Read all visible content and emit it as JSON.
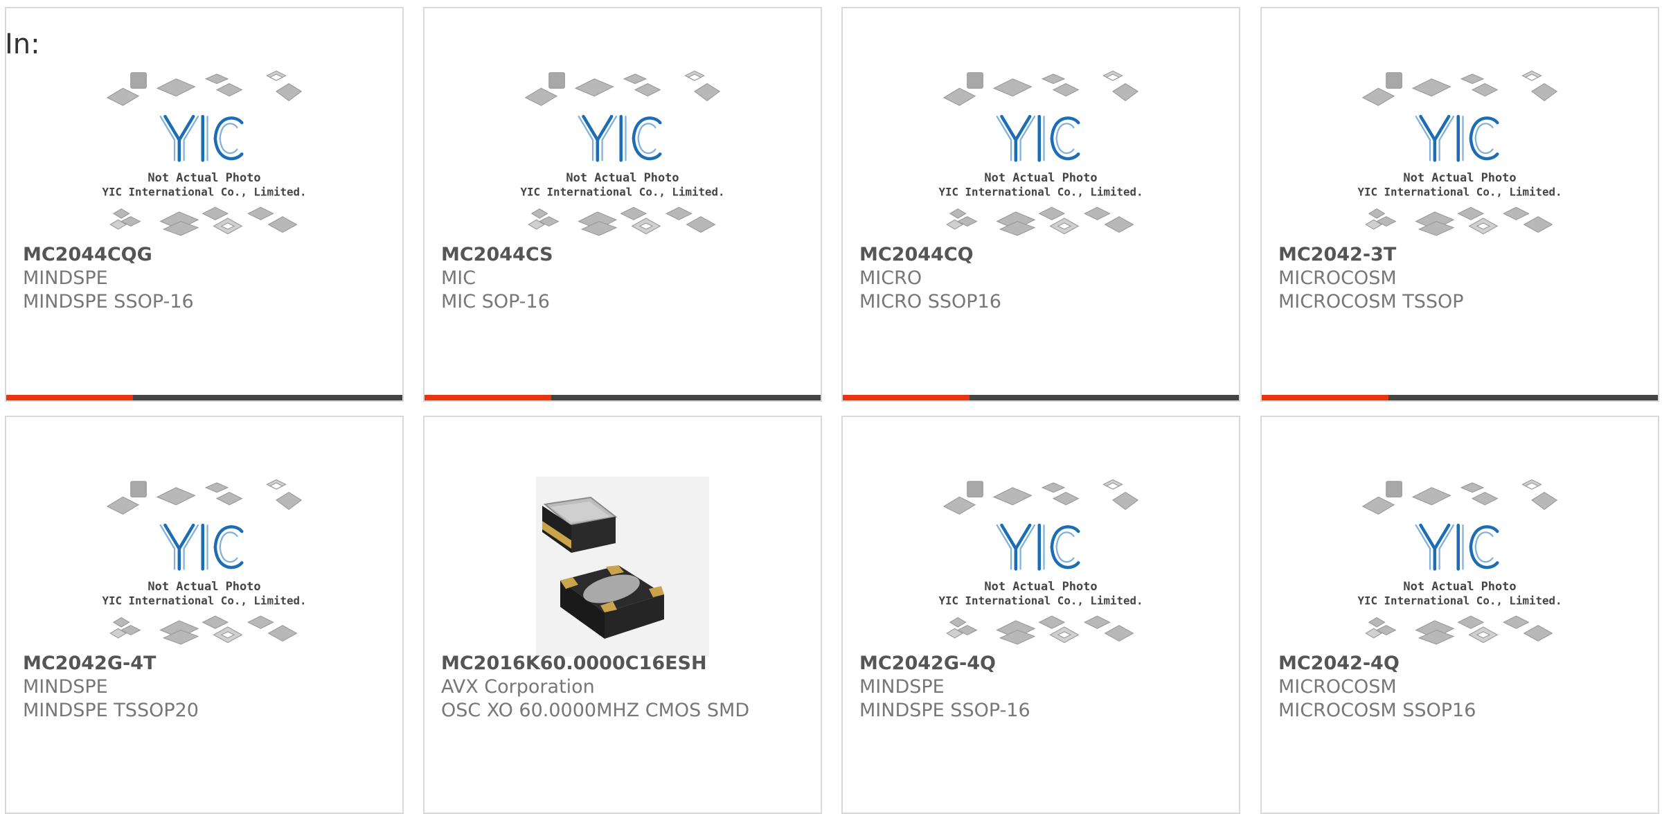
{
  "page": {
    "label": "In:"
  },
  "theme": {
    "accent": "#e8340f",
    "bar": "#444444",
    "border": "#d9d9d9",
    "logo_blue": "#1d6db5"
  },
  "placeholder_image": {
    "icon": "yic-placeholder-icon",
    "caption_line1": "Not Actual Photo",
    "caption_line2": "YIC International Co., Limited."
  },
  "products": [
    {
      "part_number": "MC2044CQG",
      "manufacturer": "MINDSPE",
      "description": "MINDSPE SSOP-16",
      "image": "placeholder"
    },
    {
      "part_number": "MC2044CS",
      "manufacturer": "MIC",
      "description": "MIC SOP-16",
      "image": "placeholder"
    },
    {
      "part_number": "MC2044CQ",
      "manufacturer": "MICRO",
      "description": "MICRO SSOP16",
      "image": "placeholder"
    },
    {
      "part_number": "MC2042-3T",
      "manufacturer": "MICROCOSM",
      "description": "MICROCOSM TSSOP",
      "image": "placeholder"
    },
    {
      "part_number": "MC2042G-4T",
      "manufacturer": "MINDSPE",
      "description": "MINDSPE TSSOP20",
      "image": "placeholder"
    },
    {
      "part_number": "MC2016K60.0000C16ESH",
      "manufacturer": "AVX Corporation",
      "description": "OSC XO 60.0000MHZ CMOS SMD",
      "image": "oscillator-photo"
    },
    {
      "part_number": "MC2042G-4Q",
      "manufacturer": "MINDSPE",
      "description": "MINDSPE SSOP-16",
      "image": "placeholder"
    },
    {
      "part_number": "MC2042-4Q",
      "manufacturer": "MICROCOSM",
      "description": "MICROCOSM SSOP16",
      "image": "placeholder"
    }
  ]
}
